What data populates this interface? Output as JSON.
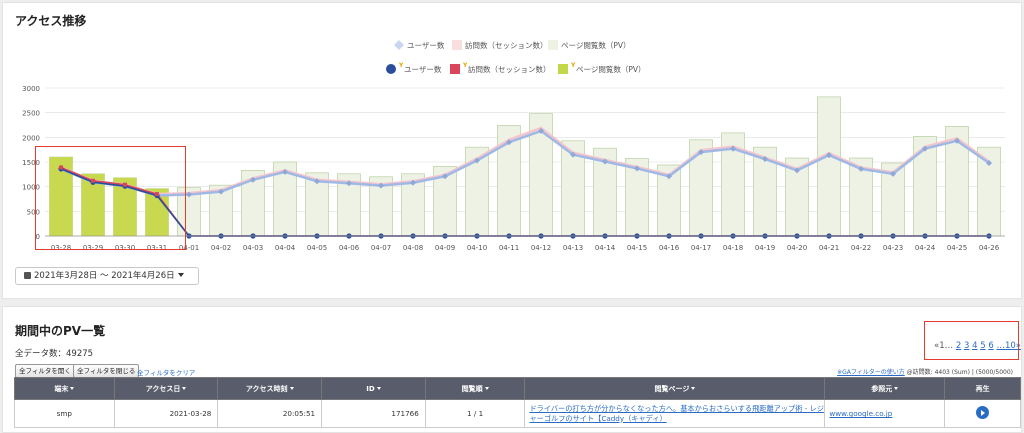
{
  "chart_panel": {
    "title": "アクセス推移",
    "date_range_label": "2021年3月28日 ～ 2021年4月26日"
  },
  "chart_data": {
    "type": "bar",
    "categories": [
      "03-28",
      "03-29",
      "03-30",
      "03-31",
      "04-01",
      "04-02",
      "04-03",
      "04-04",
      "04-05",
      "04-06",
      "04-07",
      "04-08",
      "04-09",
      "04-10",
      "04-11",
      "04-12",
      "04-13",
      "04-14",
      "04-15",
      "04-16",
      "04-17",
      "04-18",
      "04-19",
      "04-20",
      "04-21",
      "04-22",
      "04-23",
      "04-24",
      "04-25",
      "04-26"
    ],
    "yticks": [
      0,
      500,
      1000,
      1500,
      2000,
      2500,
      3000
    ],
    "ylim": [
      0,
      3000
    ],
    "grid": true,
    "legend_top": [
      {
        "name": "ユーザー数",
        "color": "#c9d6ef",
        "marker": "diamond"
      },
      {
        "name": "訪問数（セッション数）",
        "color": "#f9dede",
        "marker": "square"
      },
      {
        "name": "ページ閲覧数（PV）",
        "color": "#edf2e4",
        "marker": "square"
      }
    ],
    "legend_bottom": [
      {
        "name": "ユーザー数",
        "color": "#2b4e9a",
        "marker": "circle",
        "prefix": "Y"
      },
      {
        "name": "訪問数（セッション数）",
        "color": "#d9455b",
        "marker": "square",
        "prefix": "Y"
      },
      {
        "name": "ページ閲覧数（PV）",
        "color": "#c2d84a",
        "marker": "square",
        "prefix": "Y"
      }
    ],
    "series_previous": {
      "pv": [
        1600,
        1260,
        1180,
        960,
        980,
        1030,
        1330,
        1500,
        1280,
        1260,
        1200,
        1260,
        1410,
        1800,
        2240,
        2480,
        1930,
        1780,
        1570,
        1440,
        1950,
        2090,
        1800,
        1580,
        2820,
        1580,
        1480,
        2020,
        2220,
        1800
      ],
      "users": [
        1360,
        1090,
        1010,
        820,
        840,
        900,
        1140,
        1300,
        1110,
        1070,
        1020,
        1080,
        1210,
        1530,
        1900,
        2130,
        1650,
        1510,
        1370,
        1210,
        1700,
        1770,
        1560,
        1330,
        1640,
        1360,
        1260,
        1770,
        1930,
        1480
      ],
      "visits": [
        1390,
        1120,
        1040,
        850,
        870,
        930,
        1170,
        1330,
        1140,
        1100,
        1050,
        1110,
        1240,
        1570,
        1950,
        2190,
        1690,
        1540,
        1400,
        1240,
        1740,
        1810,
        1590,
        1360,
        1680,
        1390,
        1290,
        1810,
        1980,
        1510
      ]
    },
    "series_current": {
      "pv": [
        1600,
        1260,
        1180,
        960,
        0,
        0,
        0,
        0,
        0,
        0,
        0,
        0,
        0,
        0,
        0,
        0,
        0,
        0,
        0,
        0,
        0,
        0,
        0,
        0,
        0,
        0,
        0,
        0,
        0,
        0
      ],
      "users": [
        1360,
        1090,
        1010,
        820,
        0,
        0,
        0,
        0,
        0,
        0,
        0,
        0,
        0,
        0,
        0,
        0,
        0,
        0,
        0,
        0,
        0,
        0,
        0,
        0,
        0,
        0,
        0,
        0,
        0,
        0
      ],
      "visits": [
        1390,
        1120,
        1040,
        850,
        0,
        0,
        0,
        0,
        0,
        0,
        0,
        0,
        0,
        0,
        0,
        0,
        0,
        0,
        0,
        0,
        0,
        0,
        0,
        0,
        0,
        0,
        0,
        0,
        0,
        0
      ]
    },
    "colors": {
      "prev_bar_fill": "#edf2e4",
      "prev_bar_stroke": "#b8cfa0",
      "cur_bar_fill": "#c8d94f",
      "users_line": "#2b4e9a",
      "visits_line": "#d9455b",
      "prev_users_line": "#9fb8e6",
      "prev_visits_line": "#f4c6cc",
      "grid": "#dddddd"
    }
  },
  "table_panel": {
    "title": "期間中のPV一覧",
    "total_label": "全データ数：49275",
    "open_filter_label": "全フィルタを開く",
    "close_filter_label": "全フィルタを閉じる",
    "clear_filter_label": "全フィルタをクリア",
    "pager": {
      "prefix": "«1…",
      "pages": [
        "2",
        "3",
        "4",
        "5",
        "6"
      ],
      "ellipsis_last": "…10»"
    },
    "ga_filter_link": "※GAフィルターの使い方",
    "ga_filter_stats": "@訪問数: 4403 (Sum) | (5000/5000)",
    "columns": [
      "端末",
      "アクセス日",
      "アクセス時刻",
      "ID",
      "閲覧順",
      "閲覧ページ",
      "参照元",
      "再生"
    ],
    "rows": [
      {
        "device": "smp",
        "date": "2021-03-28",
        "time": "20:05:51",
        "id": "171766",
        "order": "1 / 1",
        "page": "ドライバーの打ち方が分からなくなった方へ。基本からおさらいする飛距離アップ術 - レジャーゴルフのサイト【Caddy（キャディ）",
        "referrer": "www.google.co.jp"
      }
    ]
  }
}
